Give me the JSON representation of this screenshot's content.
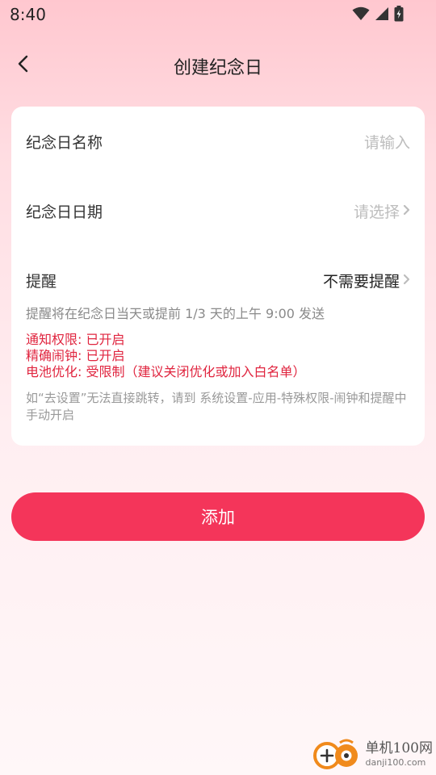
{
  "status_bar": {
    "time": "8:40",
    "icons": [
      "wifi-icon",
      "cellular-icon",
      "battery-icon"
    ]
  },
  "app_bar": {
    "back_icon": "chevron-left-icon",
    "title": "创建纪念日"
  },
  "form": {
    "name_row": {
      "label": "纪念日名称",
      "placeholder": "请输入"
    },
    "date_row": {
      "label": "纪念日日期",
      "placeholder": "请选择"
    },
    "reminder_row": {
      "label": "提醒",
      "value": "不需要提醒"
    },
    "reminder_note": "提醒将在纪念日当天或提前 1/3 天的上午 9:00 发送",
    "permissions": {
      "notification": "通知权限: 已开启",
      "alarm": "精确闹钟: 已开启",
      "battery": "电池优化: 受限制（建议关闭优化或加入白名单）"
    },
    "help_text": "如“去设置”无法直接跳转，请到 系统设置-应用-特殊权限-闹钟和提醒中手动开启"
  },
  "add_button": {
    "label": "添加"
  },
  "watermark": {
    "name": "单机100网",
    "url": "danji100.com"
  },
  "colors": {
    "accent": "#f4355a",
    "warning_text": "#e0253f",
    "background_top": "#ffc7cf",
    "background_bottom": "#fff7f8"
  }
}
